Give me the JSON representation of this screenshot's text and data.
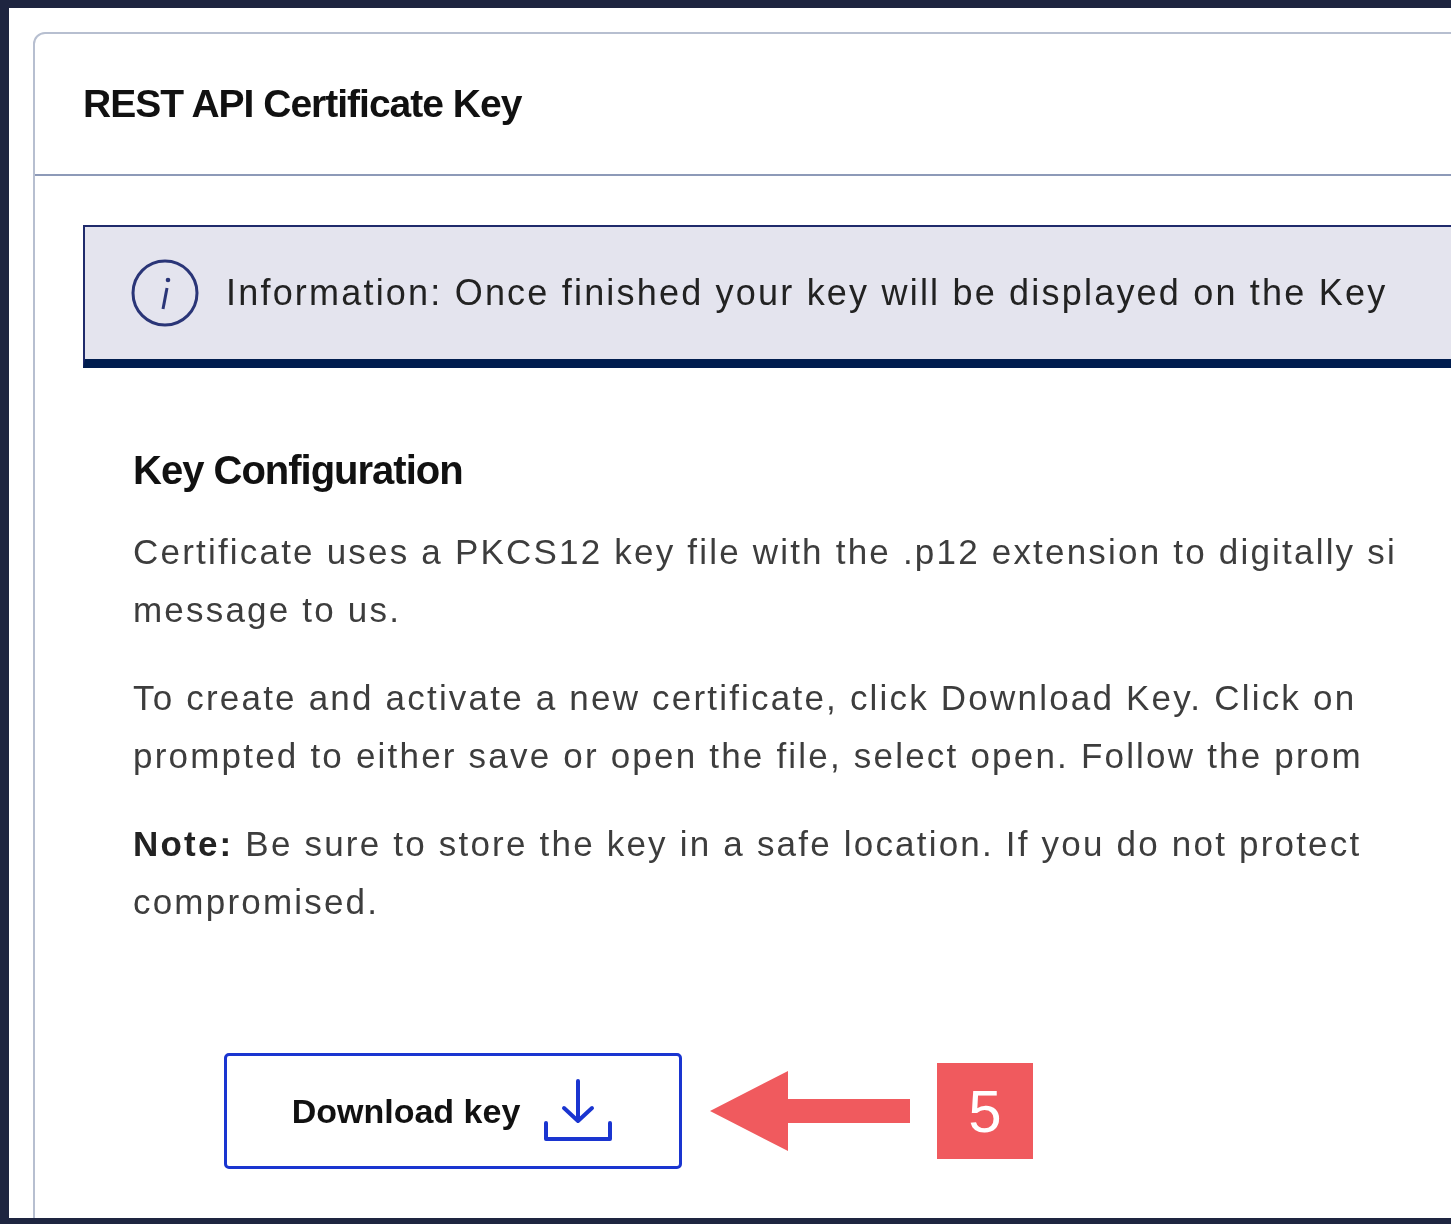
{
  "card": {
    "title": "REST API Certificate Key"
  },
  "info_banner": {
    "text": "Information: Once finished your key will be displayed on the Key"
  },
  "section": {
    "heading": "Key Configuration",
    "paragraphs": [
      {
        "lines": [
          "Certificate uses a PKCS12 key file with the .p12 extension to digitally si",
          "message to us."
        ]
      },
      {
        "lines": [
          "To create and activate a new certificate, click Download Key. Click on",
          "prompted to either save or open the file, select open. Follow the prom"
        ]
      },
      {
        "lines": [
          "**Note:** Be sure to store the key in a safe location. If you do not protect",
          "compromised."
        ]
      }
    ]
  },
  "button": {
    "label": "Download key"
  },
  "callout": {
    "number": "5"
  }
}
